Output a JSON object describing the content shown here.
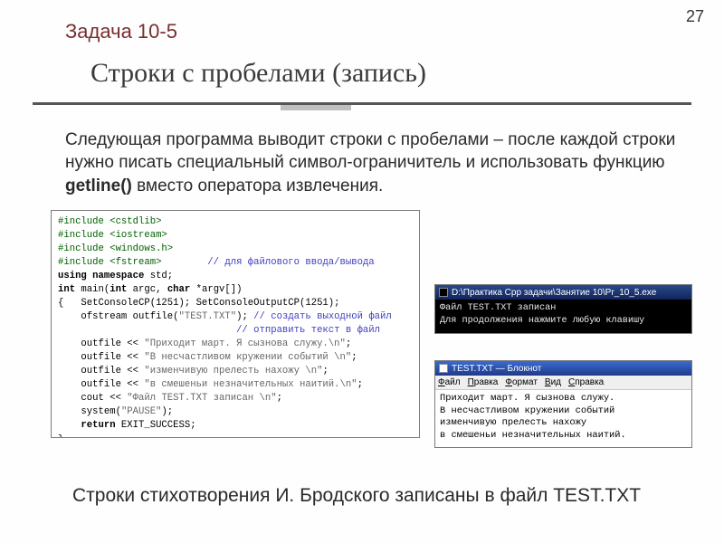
{
  "page_number": "27",
  "task_label": "Задача 10-5",
  "title": "Строки с пробелами (запись)",
  "paragraph_pre": "Следующая программа выводит строки с пробелами – после каждой строки нужно писать специальный символ-ограничитель и использовать функцию ",
  "paragraph_bold": "getline()",
  "paragraph_post": " вместо оператора извлечения.",
  "code": {
    "l1a": "#include",
    "l1b": " <cstdlib>",
    "l2a": "#include",
    "l2b": " <iostream>",
    "l3a": "#include",
    "l3b": " <windows.h>",
    "l4a": "#include",
    "l4b": " <fstream>",
    "l4c": "        // для файлового ввода/вывода",
    "l5a": "using namespace",
    "l5b": " std;",
    "l6a": "int",
    "l6b": " main(",
    "l6c": "int",
    "l6d": " argc, ",
    "l6e": "char",
    "l6f": " *argv[])",
    "l7": "{   SetConsoleCP(1251); SetConsoleOutputCP(1251);",
    "l8a": "    ofstream outfile(",
    "l8s": "\"TEST.TXT\"",
    "l8b": "); ",
    "l8c": "// создать выходной файл",
    "l9": "                               // отправить текст в файл",
    "l10a": "    outfile << ",
    "l10s": "\"Приходит март. Я сызнова служу.\\n\"",
    "l10b": ";",
    "l11a": "    outfile << ",
    "l11s": "\"В несчастливом кружении событий \\n\"",
    "l11b": ";",
    "l12a": "    outfile << ",
    "l12s": "\"изменчивую прелесть нахожу \\n\"",
    "l12b": ";",
    "l13a": "    outfile << ",
    "l13s": "\"в смешеньи незначительных наитий.\\n\"",
    "l13b": ";",
    "l14a": "    cout << ",
    "l14s": "\"Файл TEST.TXT записан \\n\"",
    "l14b": ";",
    "l15a": "    system(",
    "l15s": "\"PAUSE\"",
    "l15b": ");",
    "l16a": "    return",
    "l16b": " EXIT_SUCCESS;",
    "l17": "}"
  },
  "console": {
    "title": "D:\\Практика Cpp задачи\\Занятие 10\\Pr_10_5.exe",
    "line1": "Файл TEST.TXT записан",
    "line2": "Для продолжения нажмите любую клавишу"
  },
  "notepad": {
    "title": "TEST.TXT — Блокнот",
    "menu": {
      "m1": "Файл",
      "m2": "Правка",
      "m3": "Формат",
      "m4": "Вид",
      "m5": "Справка"
    },
    "body1": "Приходит март. Я сызнова служу.",
    "body2": "В несчастливом кружении событий",
    "body3": "изменчивую прелесть нахожу",
    "body4": "в смешеньи незначительных наитий."
  },
  "footer": "Строки стихотворения И. Бродского записаны в файл TEST.TXT"
}
